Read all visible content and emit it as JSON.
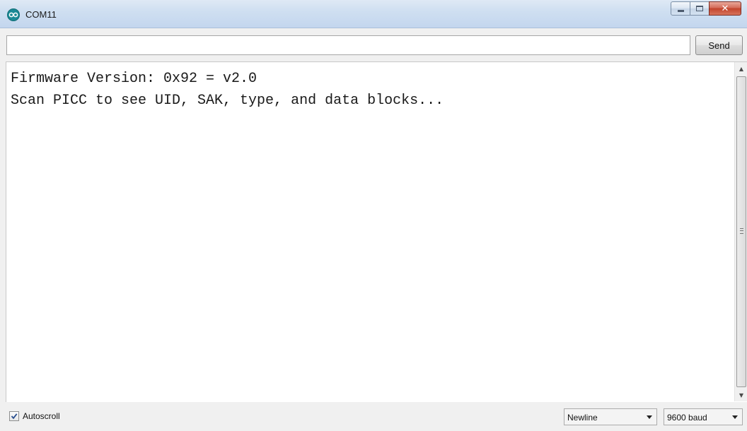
{
  "window": {
    "title": "COM11",
    "app_icon": "arduino-infinity-icon",
    "controls": [
      "minimize-icon",
      "maximize-icon",
      "close-icon"
    ]
  },
  "input_row": {
    "message_value": "",
    "send_label": "Send"
  },
  "output": {
    "lines": [
      "Firmware Version: 0x92 = v2.0",
      "Scan PICC to see UID, SAK, type, and data blocks..."
    ]
  },
  "footer": {
    "autoscroll_label": "Autoscroll",
    "autoscroll_checked": true,
    "line_ending": "Newline",
    "baud_rate": "9600 baud"
  },
  "colors": {
    "titlebar": "#cfdff1",
    "close_button": "#c2432c",
    "app_icon": "#1a8a96",
    "background": "#f0f0f0"
  }
}
